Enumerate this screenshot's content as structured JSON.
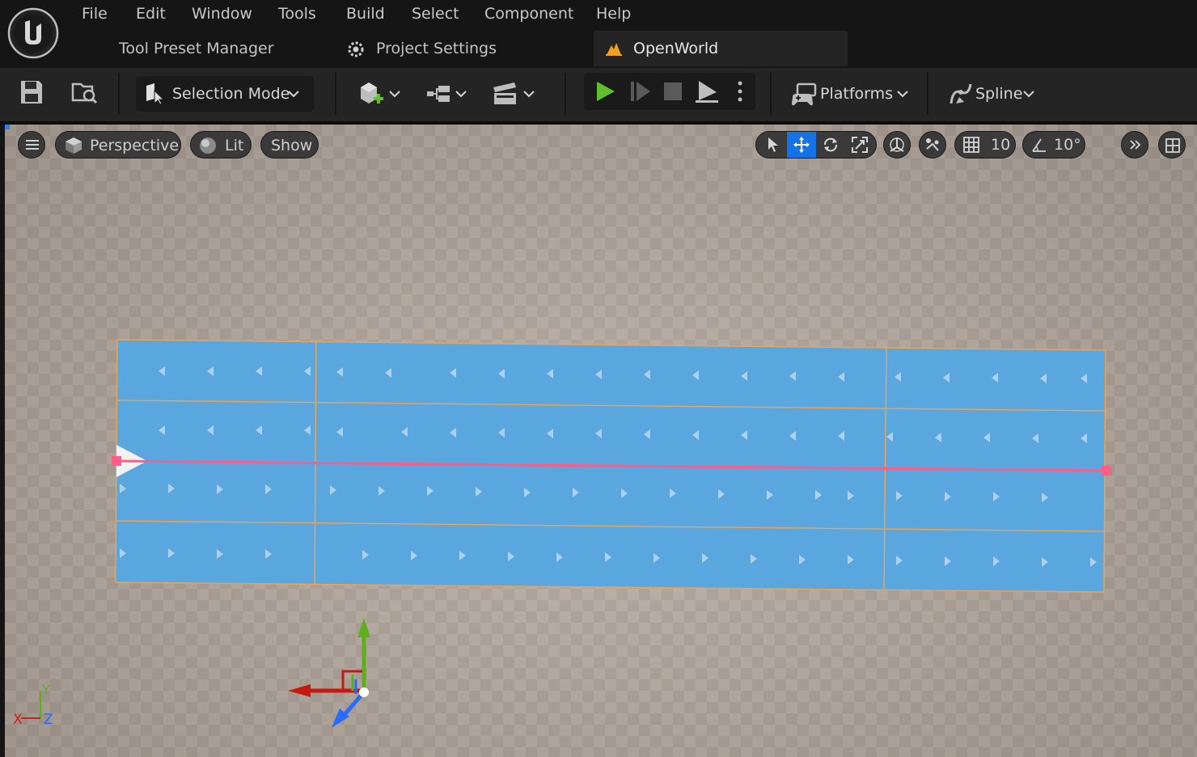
{
  "menu": {
    "items": [
      "File",
      "Edit",
      "Window",
      "Tools",
      "Build",
      "Select",
      "Component",
      "Help"
    ]
  },
  "tabs": {
    "tool_preset_manager": "Tool Preset Manager",
    "project_settings": "Project Settings",
    "open_world": "OpenWorld"
  },
  "toolbar": {
    "selection_mode": "Selection Mode",
    "platforms": "Platforms",
    "spline": "Spline"
  },
  "viewport": {
    "perspective": "Perspective",
    "lit": "Lit",
    "show": "Show",
    "grid_size": "10",
    "rotation_snap": "10°"
  },
  "axis": {
    "x": "X",
    "y": "Y",
    "z": "Z"
  },
  "colors": {
    "background": "#151515",
    "toolbar": "#242424",
    "accent_blue": "#1473e6",
    "play_green": "#5fbf2f",
    "spline_pink": "#ff5c8a",
    "water_blue": "#5aa6de",
    "mesh_edge_orange": "#e8a45a",
    "tab_icon_orange": "#f0a020"
  },
  "icons": {
    "save": "save-icon",
    "browse": "content-browser-icon",
    "selection": "cursor-icon",
    "add_actor": "add-actor-icon",
    "blueprints": "blueprint-icon",
    "cinematics": "clapperboard-icon",
    "play": "play-icon",
    "step": "step-icon",
    "stop": "stop-icon",
    "eject": "eject-icon",
    "more": "vertical-ellipsis-icon",
    "platforms": "gamepad-icon",
    "spline": "spline-icon"
  }
}
